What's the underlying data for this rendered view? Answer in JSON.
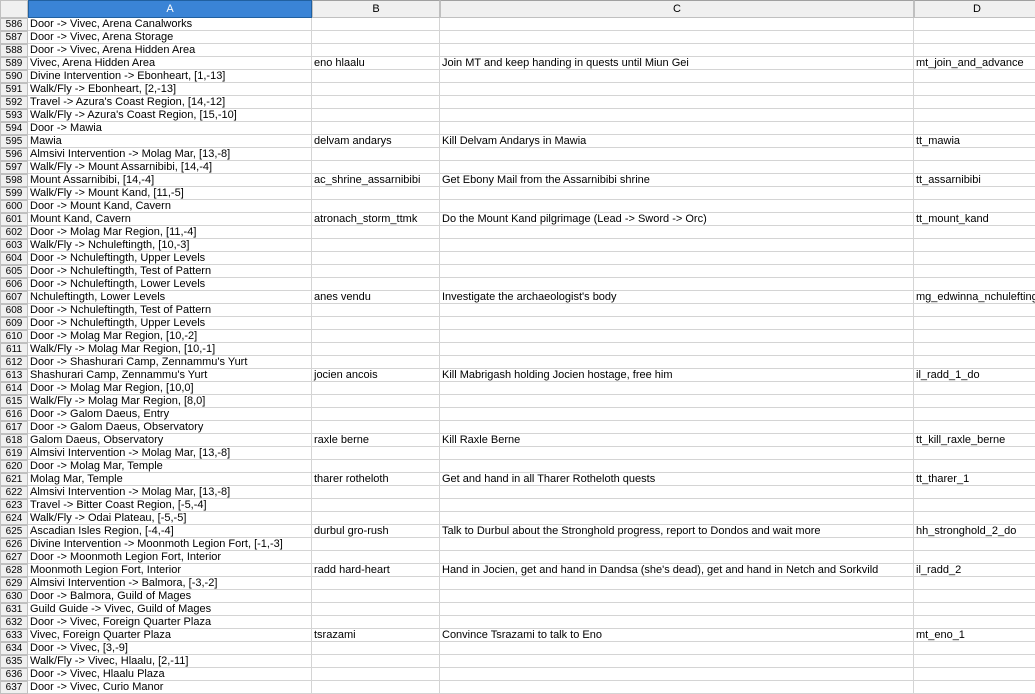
{
  "columns": [
    "A",
    "B",
    "C",
    "D"
  ],
  "selectedCol": "A",
  "startRow": 586,
  "rows": [
    {
      "n": 586,
      "a": "Door -> Vivec, Arena Canalworks",
      "b": "",
      "c": "",
      "d": ""
    },
    {
      "n": 587,
      "a": "Door -> Vivec, Arena Storage",
      "b": "",
      "c": "",
      "d": ""
    },
    {
      "n": 588,
      "a": "Door -> Vivec, Arena Hidden Area",
      "b": "",
      "c": "",
      "d": ""
    },
    {
      "n": 589,
      "a": "Vivec, Arena Hidden Area",
      "b": "eno hlaalu",
      "c": "Join MT and keep handing in quests until Miun Gei",
      "d": "mt_join_and_advance"
    },
    {
      "n": 590,
      "a": "Divine Intervention -> Ebonheart, [1,-13]",
      "b": "",
      "c": "",
      "d": ""
    },
    {
      "n": 591,
      "a": "Walk/Fly -> Ebonheart, [2,-13]",
      "b": "",
      "c": "",
      "d": ""
    },
    {
      "n": 592,
      "a": "Travel -> Azura's Coast Region, [14,-12]",
      "b": "",
      "c": "",
      "d": ""
    },
    {
      "n": 593,
      "a": "Walk/Fly -> Azura's Coast Region, [15,-10]",
      "b": "",
      "c": "",
      "d": ""
    },
    {
      "n": 594,
      "a": "Door -> Mawia",
      "b": "",
      "c": "",
      "d": ""
    },
    {
      "n": 595,
      "a": "Mawia",
      "b": "delvam andarys",
      "c": "Kill Delvam Andarys in Mawia",
      "d": "tt_mawia"
    },
    {
      "n": 596,
      "a": "Almsivi Intervention -> Molag Mar, [13,-8]",
      "b": "",
      "c": "",
      "d": ""
    },
    {
      "n": 597,
      "a": "Walk/Fly -> Mount Assarnibibi, [14,-4]",
      "b": "",
      "c": "",
      "d": ""
    },
    {
      "n": 598,
      "a": "Mount Assarnibibi, [14,-4]",
      "b": "ac_shrine_assarnibibi",
      "c": "Get Ebony Mail from the Assarnibibi shrine",
      "d": "tt_assarnibibi"
    },
    {
      "n": 599,
      "a": "Walk/Fly -> Mount Kand, [11,-5]",
      "b": "",
      "c": "",
      "d": ""
    },
    {
      "n": 600,
      "a": "Door -> Mount Kand, Cavern",
      "b": "",
      "c": "",
      "d": ""
    },
    {
      "n": 601,
      "a": "Mount Kand, Cavern",
      "b": "atronach_storm_ttmk",
      "c": "Do the Mount Kand pilgrimage (Lead -> Sword -> Orc)",
      "d": "tt_mount_kand"
    },
    {
      "n": 602,
      "a": "Door -> Molag Mar Region, [11,-4]",
      "b": "",
      "c": "",
      "d": ""
    },
    {
      "n": 603,
      "a": "Walk/Fly -> Nchuleftingth, [10,-3]",
      "b": "",
      "c": "",
      "d": ""
    },
    {
      "n": 604,
      "a": "Door -> Nchuleftingth, Upper Levels",
      "b": "",
      "c": "",
      "d": ""
    },
    {
      "n": 605,
      "a": "Door -> Nchuleftingth, Test of Pattern",
      "b": "",
      "c": "",
      "d": ""
    },
    {
      "n": 606,
      "a": "Door -> Nchuleftingth, Lower Levels",
      "b": "",
      "c": "",
      "d": ""
    },
    {
      "n": 607,
      "a": "Nchuleftingth, Lower Levels",
      "b": "anes vendu",
      "c": "Investigate the archaeologist's body",
      "d": "mg_edwinna_nchuleftingth"
    },
    {
      "n": 608,
      "a": "Door -> Nchuleftingth, Test of Pattern",
      "b": "",
      "c": "",
      "d": ""
    },
    {
      "n": 609,
      "a": "Door -> Nchuleftingth, Upper Levels",
      "b": "",
      "c": "",
      "d": ""
    },
    {
      "n": 610,
      "a": "Door -> Molag Mar Region, [10,-2]",
      "b": "",
      "c": "",
      "d": ""
    },
    {
      "n": 611,
      "a": "Walk/Fly -> Molag Mar Region, [10,-1]",
      "b": "",
      "c": "",
      "d": ""
    },
    {
      "n": 612,
      "a": "Door -> Shashurari Camp, Zennammu's Yurt",
      "b": "",
      "c": "",
      "d": ""
    },
    {
      "n": 613,
      "a": "Shashurari Camp, Zennammu's Yurt",
      "b": "jocien ancois",
      "c": "Kill Mabrigash holding Jocien hostage, free him",
      "d": "il_radd_1_do"
    },
    {
      "n": 614,
      "a": "Door -> Molag Mar Region, [10,0]",
      "b": "",
      "c": "",
      "d": ""
    },
    {
      "n": 615,
      "a": "Walk/Fly -> Molag Mar Region, [8,0]",
      "b": "",
      "c": "",
      "d": ""
    },
    {
      "n": 616,
      "a": "Door -> Galom Daeus, Entry",
      "b": "",
      "c": "",
      "d": ""
    },
    {
      "n": 617,
      "a": "Door -> Galom Daeus, Observatory",
      "b": "",
      "c": "",
      "d": ""
    },
    {
      "n": 618,
      "a": "Galom Daeus, Observatory",
      "b": "raxle berne",
      "c": "Kill Raxle Berne",
      "d": "tt_kill_raxle_berne"
    },
    {
      "n": 619,
      "a": "Almsivi Intervention -> Molag Mar, [13,-8]",
      "b": "",
      "c": "",
      "d": ""
    },
    {
      "n": 620,
      "a": "Door -> Molag Mar, Temple",
      "b": "",
      "c": "",
      "d": ""
    },
    {
      "n": 621,
      "a": "Molag Mar, Temple",
      "b": "tharer rotheloth",
      "c": "Get and hand in all Tharer Rotheloth quests",
      "d": "tt_tharer_1"
    },
    {
      "n": 622,
      "a": "Almsivi Intervention -> Molag Mar, [13,-8]",
      "b": "",
      "c": "",
      "d": ""
    },
    {
      "n": 623,
      "a": "Travel -> Bitter Coast Region, [-5,-4]",
      "b": "",
      "c": "",
      "d": ""
    },
    {
      "n": 624,
      "a": "Walk/Fly -> Odai Plateau, [-5,-5]",
      "b": "",
      "c": "",
      "d": ""
    },
    {
      "n": 625,
      "a": "Ascadian Isles Region, [-4,-4]",
      "b": "durbul gro-rush",
      "c": "Talk to Durbul about the Stronghold progress, report to Dondos and wait more",
      "d": "hh_stronghold_2_do"
    },
    {
      "n": 626,
      "a": "Divine Intervention -> Moonmoth Legion Fort, [-1,-3]",
      "b": "",
      "c": "",
      "d": ""
    },
    {
      "n": 627,
      "a": "Door -> Moonmoth Legion Fort, Interior",
      "b": "",
      "c": "",
      "d": ""
    },
    {
      "n": 628,
      "a": "Moonmoth Legion Fort, Interior",
      "b": "radd hard-heart",
      "c": "Hand in Jocien, get and hand in Dandsa (she's dead), get and hand in Netch and Sorkvild",
      "d": "il_radd_2"
    },
    {
      "n": 629,
      "a": "Almsivi Intervention -> Balmora, [-3,-2]",
      "b": "",
      "c": "",
      "d": ""
    },
    {
      "n": 630,
      "a": "Door -> Balmora, Guild of Mages",
      "b": "",
      "c": "",
      "d": ""
    },
    {
      "n": 631,
      "a": "Guild Guide -> Vivec, Guild of Mages",
      "b": "",
      "c": "",
      "d": ""
    },
    {
      "n": 632,
      "a": "Door -> Vivec, Foreign Quarter Plaza",
      "b": "",
      "c": "",
      "d": ""
    },
    {
      "n": 633,
      "a": "Vivec, Foreign Quarter Plaza",
      "b": "tsrazami",
      "c": "Convince Tsrazami to talk to Eno",
      "d": "mt_eno_1"
    },
    {
      "n": 634,
      "a": "Door -> Vivec, [3,-9]",
      "b": "",
      "c": "",
      "d": ""
    },
    {
      "n": 635,
      "a": "Walk/Fly -> Vivec, Hlaalu, [2,-11]",
      "b": "",
      "c": "",
      "d": ""
    },
    {
      "n": 636,
      "a": "Door -> Vivec, Hlaalu Plaza",
      "b": "",
      "c": "",
      "d": ""
    },
    {
      "n": 637,
      "a": "Door -> Vivec, Curio Manor",
      "b": "",
      "c": "",
      "d": ""
    }
  ]
}
